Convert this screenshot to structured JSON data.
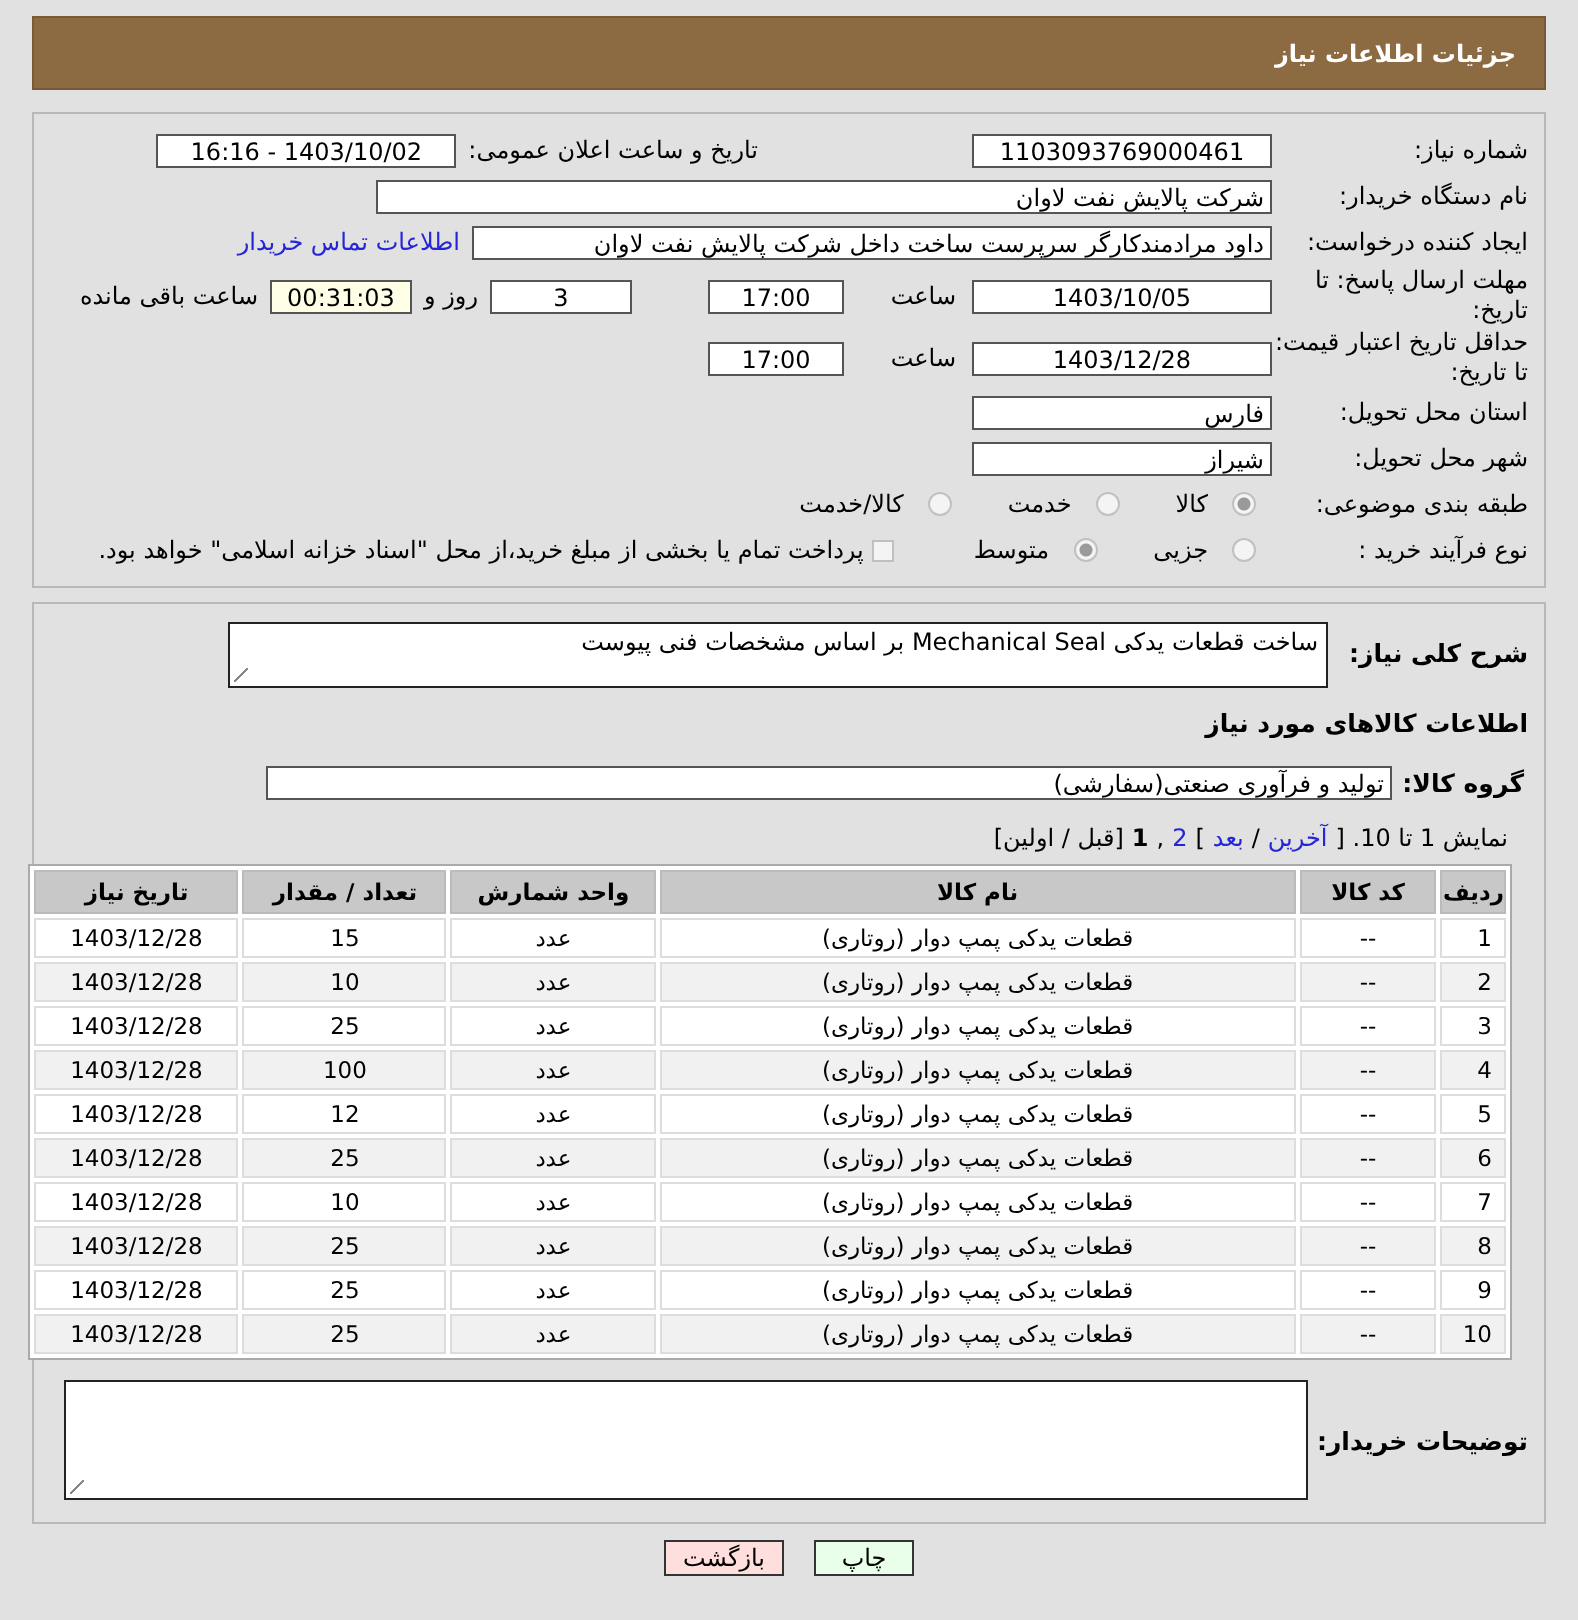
{
  "header": {
    "title": "جزئیات اطلاعات نیاز"
  },
  "need_number": {
    "label": "شماره نیاز:",
    "value": "1103093769000461"
  },
  "announce": {
    "label": "تاریخ و ساعت اعلان عمومی:",
    "value": "1403/10/02 - 16:16"
  },
  "buyer_org": {
    "label": "نام دستگاه خریدار:",
    "value": "شرکت پالایش نفت لاوان"
  },
  "creator": {
    "label": "ایجاد کننده درخواست:",
    "value": "داود مرادمندکارگر سرپرست ساخت داخل شرکت پالایش نفت لاوان",
    "link": "اطلاعات تماس خریدار"
  },
  "reply_deadline": {
    "label": "مهلت ارسال پاسخ: تا تاریخ:",
    "date": "1403/10/05",
    "time_label": "ساعت",
    "time": "17:00",
    "days": "3",
    "days_label": "روز و",
    "remaining": "00:31:03",
    "remaining_label": "ساعت باقی مانده"
  },
  "price_validity": {
    "label": "حداقل تاریخ اعتبار قیمت: تا تاریخ:",
    "date": "1403/12/28",
    "time_label": "ساعت",
    "time": "17:00"
  },
  "province": {
    "label": "استان محل تحویل:",
    "value": "فارس"
  },
  "city": {
    "label": "شهر محل تحویل:",
    "value": "شیراز"
  },
  "category": {
    "label": "طبقه بندی موضوعی:",
    "options": [
      {
        "label": "کالا",
        "selected": true
      },
      {
        "label": "خدمت",
        "selected": false
      },
      {
        "label": "کالا/خدمت",
        "selected": false
      }
    ]
  },
  "process": {
    "label": "نوع فرآیند خرید :",
    "options": [
      {
        "label": "جزیی",
        "selected": false
      },
      {
        "label": "متوسط",
        "selected": true
      }
    ],
    "treasury": {
      "label": "پرداخت تمام یا بخشی از مبلغ خرید،از محل \"اسناد خزانه اسلامی\" خواهد بود.",
      "checked": false
    }
  },
  "description": {
    "label": "شرح کلی نیاز:",
    "value": "ساخت قطعات یدکی Mechanical Seal بر اساس مشخصات فنی پیوست"
  },
  "goods_title": "اطلاعات کالاهای مورد نیاز",
  "goods_group": {
    "label": "گروه کالا:",
    "value": "تولید و فرآوری صنعتی(سفارشی)"
  },
  "pager": [
    {
      "kind": "text",
      "text": "نمایش 1 تا 10. ["
    },
    {
      "kind": "link",
      "text": "آخرین"
    },
    {
      "kind": "text",
      "text": "/"
    },
    {
      "kind": "link",
      "text": "بعد"
    },
    {
      "kind": "text",
      "text": "]"
    },
    {
      "kind": "link",
      "text": "2"
    },
    {
      "kind": "text",
      "text": ","
    },
    {
      "kind": "current",
      "text": "1"
    },
    {
      "kind": "text",
      "text": "[قبل / اولین]"
    }
  ],
  "table": {
    "columns": [
      "ردیف",
      "کد کالا",
      "نام کالا",
      "واحد شمارش",
      "تعداد / مقدار",
      "تاریخ نیاز"
    ],
    "rows": [
      [
        "1",
        "--",
        "قطعات یدکی پمپ دوار (روتاری)",
        "عدد",
        "15",
        "1403/12/28"
      ],
      [
        "2",
        "--",
        "قطعات یدکی پمپ دوار (روتاری)",
        "عدد",
        "10",
        "1403/12/28"
      ],
      [
        "3",
        "--",
        "قطعات یدکی پمپ دوار (روتاری)",
        "عدد",
        "25",
        "1403/12/28"
      ],
      [
        "4",
        "--",
        "قطعات یدکی پمپ دوار (روتاری)",
        "عدد",
        "100",
        "1403/12/28"
      ],
      [
        "5",
        "--",
        "قطعات یدکی پمپ دوار (روتاری)",
        "عدد",
        "12",
        "1403/12/28"
      ],
      [
        "6",
        "--",
        "قطعات یدکی پمپ دوار (روتاری)",
        "عدد",
        "25",
        "1403/12/28"
      ],
      [
        "7",
        "--",
        "قطعات یدکی پمپ دوار (روتاری)",
        "عدد",
        "10",
        "1403/12/28"
      ],
      [
        "8",
        "--",
        "قطعات یدکی پمپ دوار (روتاری)",
        "عدد",
        "25",
        "1403/12/28"
      ],
      [
        "9",
        "--",
        "قطعات یدکی پمپ دوار (روتاری)",
        "عدد",
        "25",
        "1403/12/28"
      ],
      [
        "10",
        "--",
        "قطعات یدکی پمپ دوار (روتاری)",
        "عدد",
        "25",
        "1403/12/28"
      ]
    ]
  },
  "buyer_notes": {
    "label": "توضیحات خریدار:"
  },
  "buttons": [
    {
      "label": "چاپ",
      "kind": "print"
    },
    {
      "label": "بازگشت",
      "kind": "back"
    }
  ]
}
